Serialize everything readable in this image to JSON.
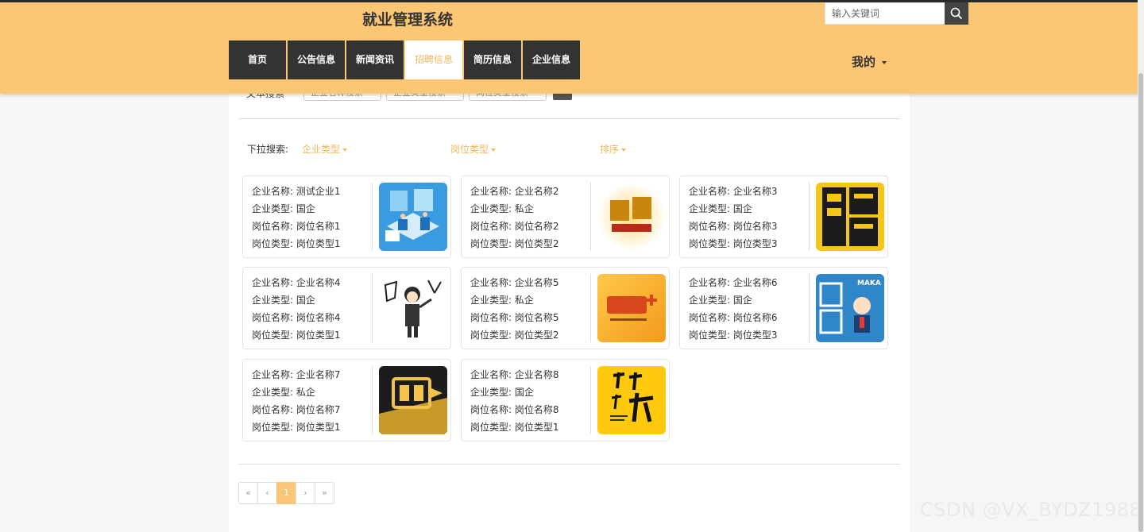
{
  "header": {
    "title": "就业管理系统",
    "nav": [
      {
        "label": "首页",
        "active": false
      },
      {
        "label": "公告信息",
        "active": false
      },
      {
        "label": "新闻资讯",
        "active": false
      },
      {
        "label": "招聘信息",
        "active": true
      },
      {
        "label": "简历信息",
        "active": false
      },
      {
        "label": "企业信息",
        "active": false
      }
    ],
    "search_placeholder": "输入关键词",
    "search_icon": "search-icon",
    "user_menu_label": "我的"
  },
  "text_search": {
    "label": "文本搜索",
    "fields": [
      "企业名称搜索",
      "企业类型搜索",
      "岗位类型搜索"
    ]
  },
  "dropdown_search": {
    "label": "下拉搜索:",
    "filters": [
      "企业类型",
      "岗位类型",
      "排序"
    ]
  },
  "jobs": [
    {
      "company_label": "企业名称:",
      "company": "测试企业1",
      "type_label": "企业类型:",
      "type": "国企",
      "pos_label": "岗位名称:",
      "position": "岗位名称1",
      "ptype_label": "岗位类型:",
      "ptype": "岗位类型1",
      "image": "office-isometric-illustration"
    },
    {
      "company_label": "企业名称:",
      "company": "企业名称2",
      "type_label": "企业类型:",
      "type": "私企",
      "pos_label": "岗位名称:",
      "position": "岗位名称2",
      "ptype_label": "岗位类型:",
      "ptype": "岗位类型2",
      "image": "jianzhi-poster"
    },
    {
      "company_label": "企业名称:",
      "company": "企业名称3",
      "type_label": "企业类型:",
      "type": "国企",
      "pos_label": "岗位名称:",
      "position": "岗位名称3",
      "ptype_label": "岗位类型:",
      "ptype": "岗位类型3",
      "image": "pin-poster"
    },
    {
      "company_label": "企业名称:",
      "company": "企业名称4",
      "type_label": "企业类型:",
      "type": "国企",
      "pos_label": "岗位名称:",
      "position": "岗位名称4",
      "ptype_label": "岗位类型:",
      "ptype": "岗位类型1",
      "image": "zhaoren-cartoon"
    },
    {
      "company_label": "企业名称:",
      "company": "企业名称5",
      "type_label": "企业类型:",
      "type": "私企",
      "pos_label": "岗位名称:",
      "position": "岗位名称5",
      "ptype_label": "岗位类型:",
      "ptype": "岗位类型2",
      "image": "zhaopin-plus-poster"
    },
    {
      "company_label": "企业名称:",
      "company": "企业名称6",
      "type_label": "企业类型:",
      "type": "国企",
      "pos_label": "岗位名称:",
      "position": "岗位名称6",
      "ptype_label": "岗位类型:",
      "ptype": "岗位类型3",
      "image": "maka-jianzhi-poster",
      "image_text": "MAKA"
    },
    {
      "company_label": "企业名称:",
      "company": "企业名称7",
      "type_label": "企业类型:",
      "type": "私企",
      "pos_label": "岗位名称:",
      "position": "岗位名称7",
      "ptype_label": "岗位类型:",
      "ptype": "岗位类型1",
      "image": "pin-dark-poster"
    },
    {
      "company_label": "企业名称:",
      "company": "企业名称8",
      "type_label": "企业类型:",
      "type": "国企",
      "pos_label": "岗位名称:",
      "position": "岗位名称8",
      "ptype_label": "岗位类型:",
      "ptype": "岗位类型1",
      "image": "women-xuyao-ni-poster"
    }
  ],
  "pagination": {
    "first": "«",
    "prev": "‹",
    "current": "1",
    "next": "›",
    "last": "»"
  },
  "watermark": "CSDN @VX_BYDZ1988",
  "colors": {
    "header_bg": "#fcc775",
    "accent": "#f2b85d",
    "nav_bg": "#333333",
    "active_page": "#fbc677"
  }
}
